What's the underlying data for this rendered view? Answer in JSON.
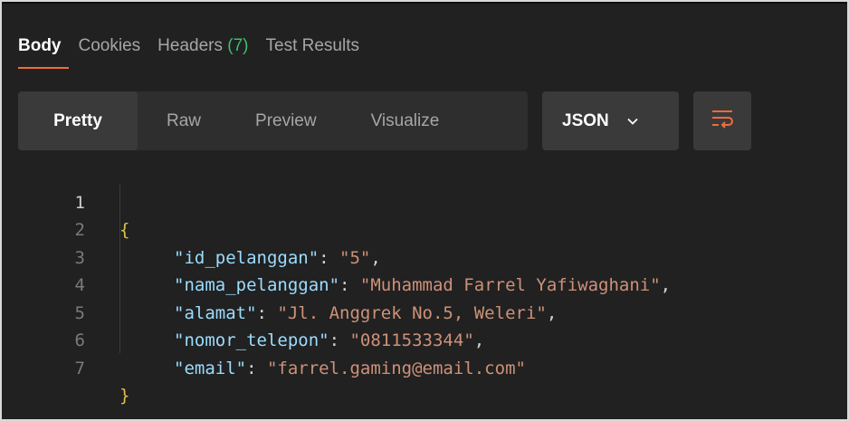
{
  "tabs": [
    {
      "label": "Body",
      "count": ""
    },
    {
      "label": "Cookies",
      "count": ""
    },
    {
      "label": "Headers ",
      "count": "(7)"
    },
    {
      "label": "Test Results",
      "count": ""
    }
  ],
  "view_modes": [
    "Pretty",
    "Raw",
    "Preview",
    "Visualize"
  ],
  "format": {
    "selected": "JSON"
  },
  "icons": {
    "format_dropdown": "chevron-down-icon",
    "wrap": "wrap-lines-icon"
  },
  "code": {
    "open_brace": "{",
    "close_brace": "}",
    "lines": [
      {
        "num": "1"
      },
      {
        "num": "2",
        "key": "\"id_pelanggan\"",
        "value": "\"5\"",
        "comma": ","
      },
      {
        "num": "3",
        "key": "\"nama_pelanggan\"",
        "value": "\"Muhammad Farrel Yafiwaghani\"",
        "comma": ","
      },
      {
        "num": "4",
        "key": "\"alamat\"",
        "value": "\"Jl. Anggrek No.5, Weleri\"",
        "comma": ","
      },
      {
        "num": "5",
        "key": "\"nomor_telepon\"",
        "value": "\"0811533344\"",
        "comma": ","
      },
      {
        "num": "6",
        "key": "\"email\"",
        "value": "\"farrel.gaming@email.com\"",
        "comma": ""
      },
      {
        "num": "7"
      }
    ]
  },
  "colors": {
    "background": "#212121",
    "accent": "#f26b3a",
    "count_green": "#3fbf6a",
    "json_key": "#9cdcfe",
    "json_string": "#ce9178",
    "brace": "#e0c04a"
  }
}
